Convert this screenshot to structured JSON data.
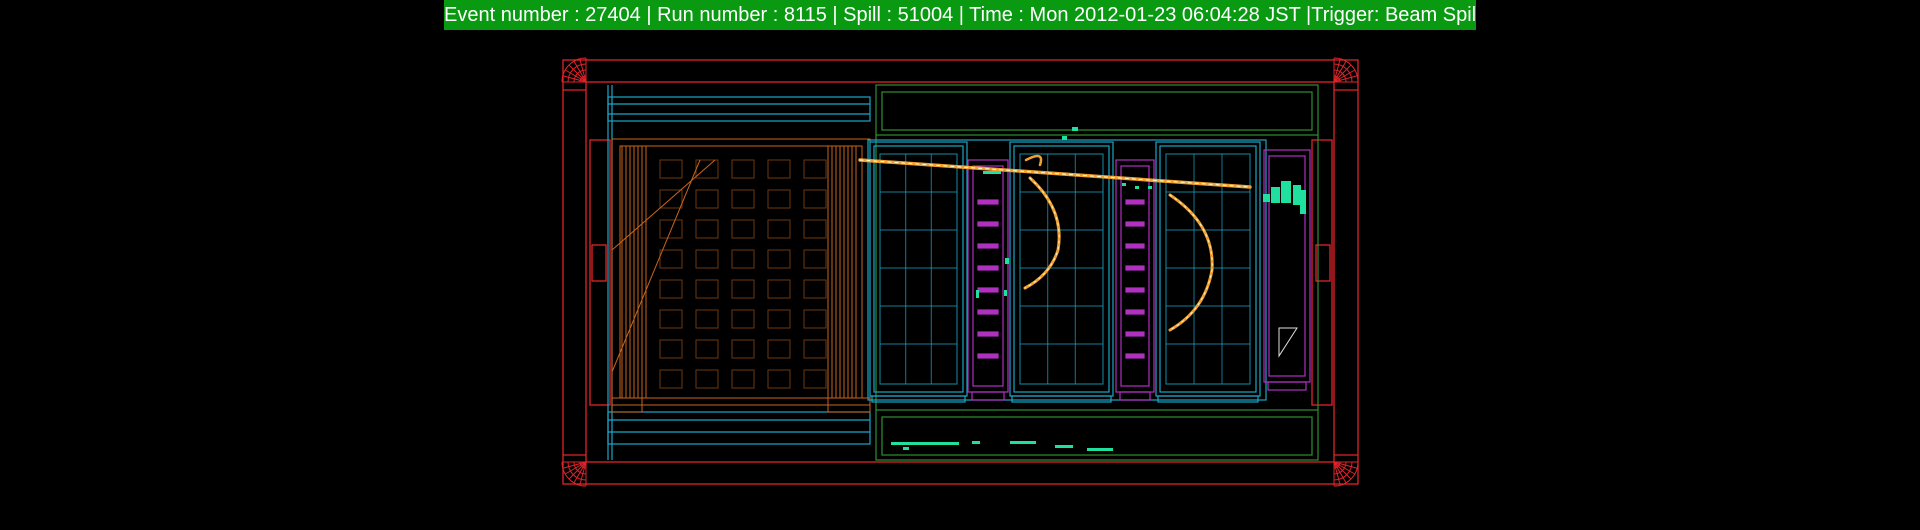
{
  "banner": {
    "text": "Event number : 27404 | Run number : 8115 | Spill : 51004 | Time : Mon 2012-01-23 06:04:28 JST |Trigger: Beam Spill"
  },
  "colors": {
    "background": "#000000",
    "banner": "#0a9a12",
    "outer_frame": "#e0242a",
    "cyan_structure": "#1aa6c8",
    "orange_module": "#c8641e",
    "green_frame": "#2f8f2f",
    "purple_module": "#b030c0",
    "track_hits": "#f0a030",
    "track_core": "#fff6c0",
    "noise_hits": "#20e0a0"
  }
}
